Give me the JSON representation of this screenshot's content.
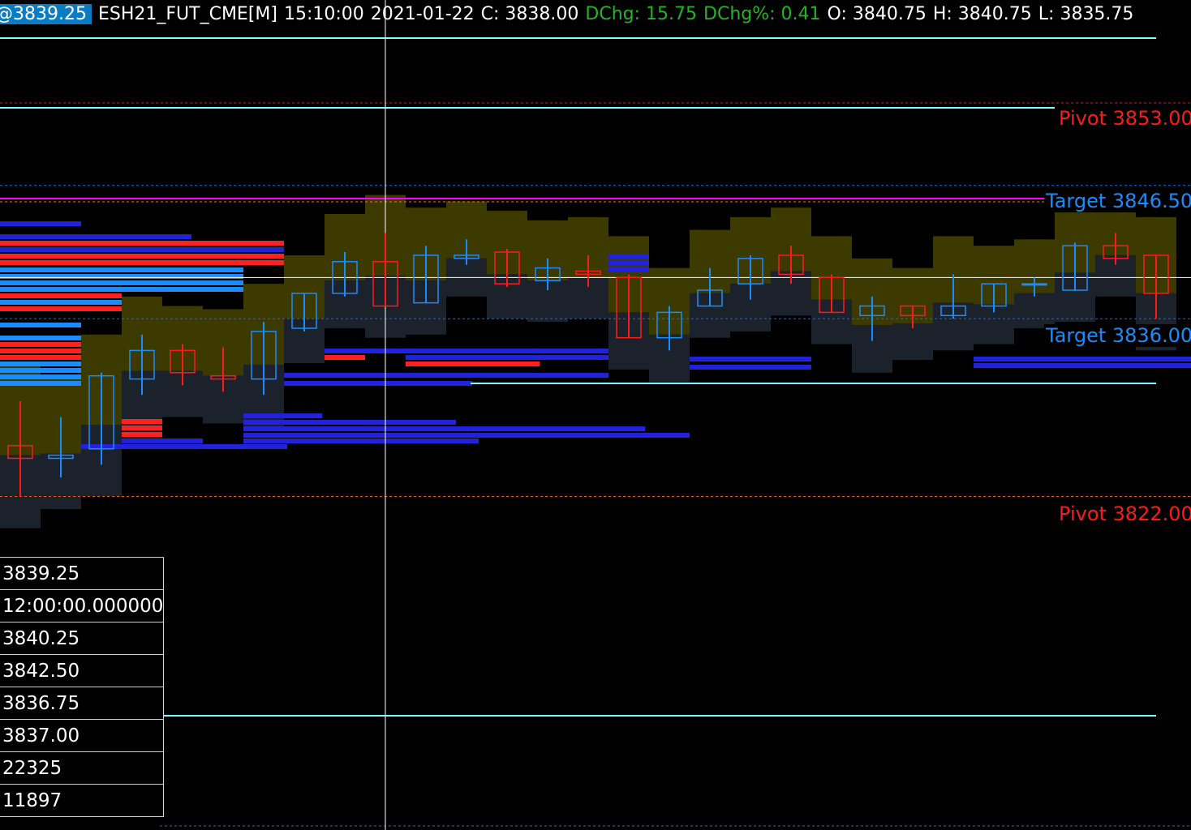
{
  "header": {
    "last_price": "@3839.25",
    "symbol": "ESH21_FUT_CME[M]",
    "time": "15:10:00",
    "date": "2021-01-22",
    "close": "C: 3838.00",
    "dchg": "DChg: 15.75",
    "dchg_pct": "DChg%: 0.41",
    "open": "O: 3840.75",
    "high": "H: 3840.75",
    "low": "L: 3835.75"
  },
  "levels": [
    {
      "label": "Pivot  3853.00",
      "price": 3853.0,
      "color": "#ff1a1a"
    },
    {
      "label": "Target  3846.50",
      "price": 3846.5,
      "color": "#1a8cff"
    },
    {
      "label": "Target  3836.00",
      "price": 3836.0,
      "color": "#1a8cff"
    },
    {
      "label": "Pivot  3822.00",
      "price": 3822.0,
      "color": "#ff1a1a"
    }
  ],
  "data_window": [
    "3839.25",
    "12:00:00.000000",
    "3840.25",
    "3842.50",
    "3836.75",
    "3837.00",
    "22325",
    "11897"
  ],
  "colors": {
    "up": "#1a8cff",
    "down": "#ff1a1a",
    "current_price_line": "#ffffff",
    "cyan_line": "#7fffff",
    "magenta_line": "#ff00ff"
  },
  "chart_data": {
    "type": "candlestick",
    "current_price": 3839.25,
    "candles": [
      {
        "o": 3826,
        "h": 3829.5,
        "l": 3822,
        "c": 3825
      },
      {
        "o": 3825,
        "h": 3828.25,
        "l": 3823.5,
        "c": 3825.25
      },
      {
        "o": 3825.75,
        "h": 3831.75,
        "l": 3824.5,
        "c": 3831.5
      },
      {
        "o": 3831.25,
        "h": 3834.75,
        "l": 3830,
        "c": 3833.5
      },
      {
        "o": 3833.5,
        "h": 3834,
        "l": 3830.75,
        "c": 3831.75
      },
      {
        "o": 3831.5,
        "h": 3833.75,
        "l": 3830.25,
        "c": 3831.25
      },
      {
        "o": 3831.25,
        "h": 3835.75,
        "l": 3830,
        "c": 3835
      },
      {
        "o": 3835.25,
        "h": 3838,
        "l": 3835,
        "c": 3838
      },
      {
        "o": 3838,
        "h": 3841.25,
        "l": 3837.75,
        "c": 3840.5
      },
      {
        "o": 3840.5,
        "h": 3842.75,
        "l": 3837,
        "c": 3837
      },
      {
        "o": 3837.25,
        "h": 3841.75,
        "l": 3837.25,
        "c": 3841
      },
      {
        "o": 3840.75,
        "h": 3842.25,
        "l": 3840.25,
        "c": 3841
      },
      {
        "o": 3841.25,
        "h": 3841.5,
        "l": 3838.5,
        "c": 3838.75
      },
      {
        "o": 3839,
        "h": 3840.75,
        "l": 3838.25,
        "c": 3840
      },
      {
        "o": 3839.75,
        "h": 3841,
        "l": 3838.5,
        "c": 3839.5
      },
      {
        "o": 3839.25,
        "h": 3839.5,
        "l": 3834.5,
        "c": 3834.5
      },
      {
        "o": 3834.5,
        "h": 3837,
        "l": 3833.5,
        "c": 3836.5
      },
      {
        "o": 3837,
        "h": 3840,
        "l": 3837,
        "c": 3838.25
      },
      {
        "o": 3838.75,
        "h": 3841,
        "l": 3837.5,
        "c": 3840.75
      },
      {
        "o": 3841,
        "h": 3841.75,
        "l": 3838.75,
        "c": 3839.5
      },
      {
        "o": 3839.25,
        "h": 3839.5,
        "l": 3836.5,
        "c": 3836.5
      },
      {
        "o": 3836.25,
        "h": 3837.75,
        "l": 3834.25,
        "c": 3837
      },
      {
        "o": 3837,
        "h": 3837,
        "l": 3835.25,
        "c": 3836.25
      },
      {
        "o": 3836.25,
        "h": 3839.5,
        "l": 3836,
        "c": 3837
      },
      {
        "o": 3837,
        "h": 3838.75,
        "l": 3836.5,
        "c": 3838.75
      },
      {
        "o": 3838.75,
        "h": 3839.25,
        "l": 3837.75,
        "c": 3838.75
      },
      {
        "o": 3838.25,
        "h": 3842,
        "l": 3838.25,
        "c": 3841.75
      },
      {
        "o": 3841.75,
        "h": 3842.75,
        "l": 3840.25,
        "c": 3840.75
      },
      {
        "o": 3841,
        "h": 3841,
        "l": 3836,
        "c": 3838
      }
    ]
  }
}
